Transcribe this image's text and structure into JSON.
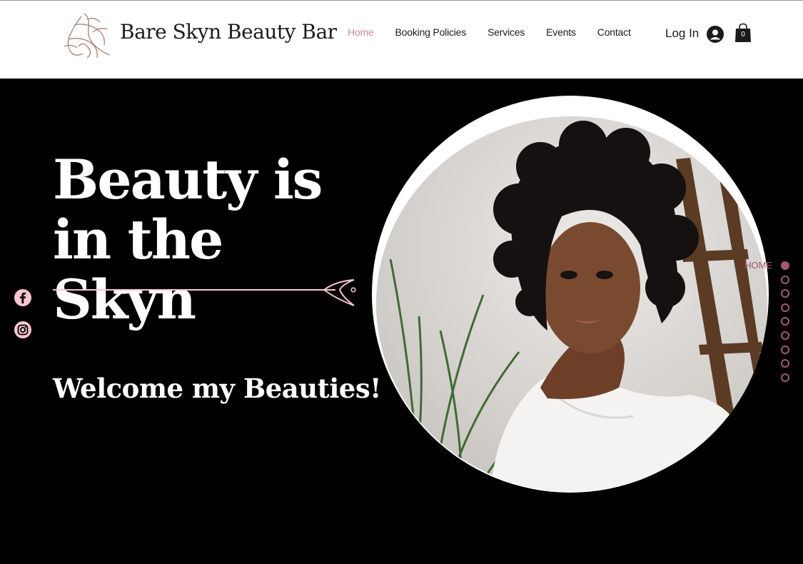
{
  "header": {
    "brand": "Bare Skyn Beauty Bar",
    "nav": [
      {
        "label": "Home",
        "active": true
      },
      {
        "label": "Booking Policies"
      },
      {
        "label": "Services"
      },
      {
        "label": "Events"
      },
      {
        "label": "Contact"
      }
    ],
    "login_label": "Log In",
    "cart_count": "0"
  },
  "hero": {
    "headline": "Beauty is in the Skyn",
    "welcome": "Welcome my Beauties!"
  },
  "social": [
    "facebook-icon",
    "instagram-icon"
  ],
  "anchor_menu": {
    "current_label": "HOME",
    "count": 9,
    "active_index": 0
  },
  "colors": {
    "accent_pink": "#f7c6cf",
    "nav_active": "#c08a9a",
    "anchor": "#a25a6f"
  }
}
